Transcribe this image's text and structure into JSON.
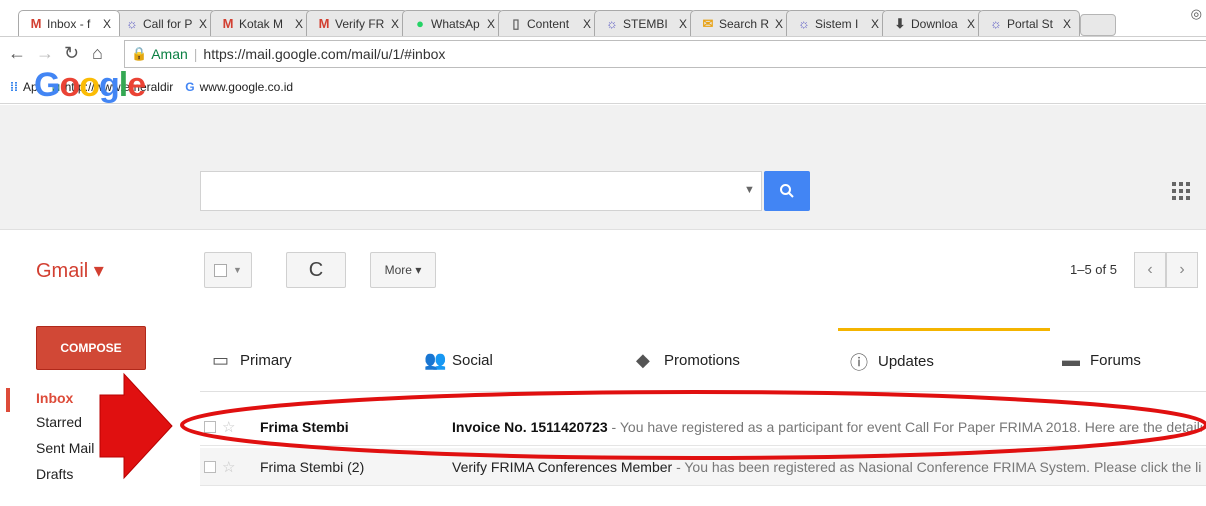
{
  "browser": {
    "tabs": [
      {
        "title": "Inbox - f",
        "icon": "gmail-icon",
        "icon_glyph": "M",
        "icon_color": "#d23f31",
        "active": true
      },
      {
        "title": "Call for P",
        "icon": "portal-icon",
        "icon_glyph": "☼",
        "icon_color": "#5b5bc4"
      },
      {
        "title": "Kotak M",
        "icon": "gmail-icon",
        "icon_glyph": "M",
        "icon_color": "#d23f31"
      },
      {
        "title": "Verify FR",
        "icon": "gmail-icon",
        "icon_glyph": "M",
        "icon_color": "#d23f31"
      },
      {
        "title": "WhatsAp",
        "icon": "whatsapp-icon",
        "icon_glyph": "●",
        "icon_color": "#25d366"
      },
      {
        "title": "Content",
        "icon": "document-icon",
        "icon_glyph": "▯",
        "icon_color": "#666666"
      },
      {
        "title": "STEMBI",
        "icon": "portal-icon",
        "icon_glyph": "☼",
        "icon_color": "#5b5bc4"
      },
      {
        "title": "Search R",
        "icon": "envelope-icon",
        "icon_glyph": "✉",
        "icon_color": "#e8a317"
      },
      {
        "title": "Sistem I",
        "icon": "portal-icon",
        "icon_glyph": "☼",
        "icon_color": "#5b5bc4"
      },
      {
        "title": "Downloa",
        "icon": "download-icon",
        "icon_glyph": "⬇",
        "icon_color": "#444444"
      },
      {
        "title": "Portal St",
        "icon": "portal-icon",
        "icon_glyph": "☼",
        "icon_color": "#5b5bc4"
      }
    ],
    "close_glyph": "X",
    "secure_label": "Aman",
    "url": "https://mail.google.com/mail/u/1/#inbox",
    "bookmarks": [
      {
        "label": "Apl",
        "icon": "apps-grid-icon",
        "glyph": "⁞⁞",
        "color": "#1a73e8"
      },
      {
        "label": "http://www.emeraldir",
        "icon": "emerald-icon",
        "glyph": "◙",
        "color": "#2a7f62"
      },
      {
        "label": "www.google.co.id",
        "icon": "google-g-icon",
        "glyph": "G",
        "color": "#4285f4"
      }
    ]
  },
  "gmail": {
    "logo": {
      "letters": [
        "G",
        "o",
        "o",
        "g",
        "l",
        "e"
      ]
    },
    "brand_label": "Gmail ▾",
    "toolbar": {
      "refresh_glyph": "C",
      "more_label": "More ▾",
      "count": "1–5 of 5"
    },
    "compose_label": "COMPOSE",
    "nav": [
      "Inbox",
      "Starred",
      "Sent Mail",
      "Drafts"
    ],
    "inbox_tabs": [
      {
        "label": "Primary",
        "icon": "inbox-icon",
        "glyph": "▭"
      },
      {
        "label": "Social",
        "icon": "people-icon",
        "glyph": "👥"
      },
      {
        "label": "Promotions",
        "icon": "tag-icon",
        "glyph": "◆"
      },
      {
        "label": "Updates",
        "icon": "info-icon",
        "glyph": "ⓘ",
        "active": true
      },
      {
        "label": "Forums",
        "icon": "forum-icon",
        "glyph": "▬"
      }
    ],
    "emails": [
      {
        "sender": "Frima Stembi",
        "subject": "Invoice No. 1511420723",
        "snippet": " - You have registered as a participant for event Call For Paper FRIMA 2018. Here are the details of the fees",
        "unread": true
      },
      {
        "sender": "Frima Stembi (2)",
        "subject": "Verify FRIMA Conferences Member",
        "snippet": " - You has been registered as Nasional Conference FRIMA System. Please click the link below to",
        "unread": false
      }
    ]
  },
  "colors": {
    "accent": "#4285f4",
    "compose": "#d14836",
    "annotation": "#e01010"
  }
}
